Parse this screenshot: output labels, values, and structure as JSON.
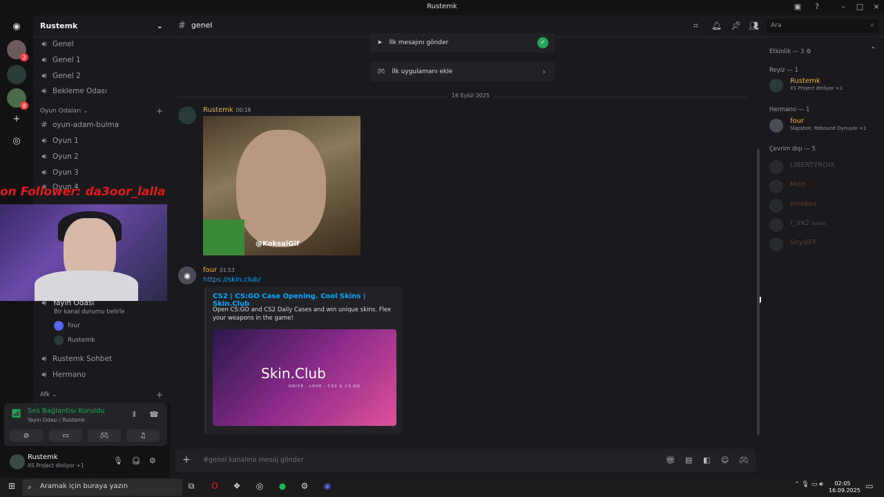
{
  "window": {
    "title": "Rustemk"
  },
  "server": {
    "name": "Rustemk",
    "channels_top": [
      "Genel",
      "Genel 1",
      "Genel 2",
      "Bekleme Odası"
    ],
    "category_games": "Oyun Odaları",
    "channels_games": [
      "oyun-adam-bulma",
      "Oyun 1",
      "Oyun 2",
      "Oyun 3",
      "Oyun 4"
    ],
    "stream_channel": "Yayın Odası",
    "stream_status": "Bir kanal durumu belirle",
    "stream_users": [
      "four",
      "Rustemk"
    ],
    "channels_bottom": [
      "Rustemk Sohbet",
      "Hermano"
    ],
    "category_afk": "Afk"
  },
  "overlay": {
    "follower_text": "on Follower: da3oor_lalla"
  },
  "voice_panel": {
    "status": "Ses Bağlantısı Kuruldu",
    "location": "Yayın Odası / Rustemk"
  },
  "user_panel": {
    "name": "Rustemk",
    "activity": "XS Project dinliyor +1"
  },
  "topbar": {
    "channel": "genel",
    "search_placeholder": "Ara"
  },
  "onboarding": [
    {
      "label": "İlk mesajını gönder",
      "done": true
    },
    {
      "label": "İlk uygulamanı ekle",
      "done": false
    }
  ],
  "date_divider": "16 Eylül 2025",
  "messages": [
    {
      "author": "Rustemk",
      "time": "00:18",
      "author_color": "#f0b232",
      "gif_watermark": "@KoksalGif"
    },
    {
      "author": "four",
      "time": "01:53",
      "author_color": "#f0b232",
      "link": "https://skin.club/",
      "embed_title": "CS2 | CS:GO Case Opening. Cool Skins | Skin.Club",
      "embed_desc": "Open CS:GO and CS2 Daily Cases and win unique skins. Flex your weapons in the game!",
      "embed_logo": "Skin.Club",
      "embed_logo_sub": "DRIVE . LOVE . CS2 & CS:GO"
    }
  ],
  "composer": {
    "placeholder": "#genel kanalına mesaj gönder"
  },
  "members": {
    "activity_header": "Etkinlik — 3",
    "groups": [
      {
        "header": "Reyiz — 1",
        "members": [
          {
            "name": "Rustemk",
            "activity": "XS Project dinliyor +1",
            "color": "#f0b232"
          }
        ]
      },
      {
        "header": "Hermano — 1",
        "members": [
          {
            "name": "four",
            "activity": "Slapshot: Rebound Oynuyor +1",
            "color": "#f0b232"
          }
        ]
      },
      {
        "header": "Çevrim dışı — 5",
        "members": [
          {
            "name": "LIBERTYROIX",
            "activity": "",
            "color": "#6a6a70"
          },
          {
            "name": "Mert",
            "activity": "",
            "color": "#7a4a2a"
          },
          {
            "name": "moskov",
            "activity": "",
            "color": "#7a4a2a"
          },
          {
            "name": "r_irk2",
            "activity": "GAGA",
            "color": "#6a6a70"
          },
          {
            "name": "SeydiFF",
            "activity": "",
            "color": "#7a4a2a"
          }
        ]
      }
    ]
  },
  "taskbar": {
    "search_placeholder": "Aramak için buraya yazın",
    "time": "02:05",
    "date": "16.09.2025"
  }
}
